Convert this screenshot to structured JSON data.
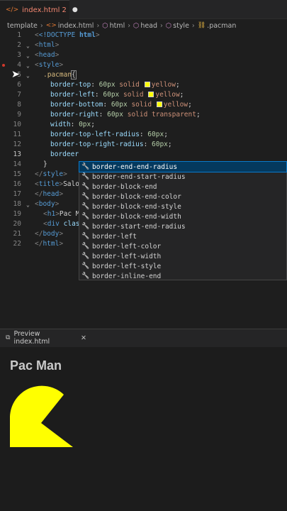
{
  "tab": {
    "title": "index.html",
    "problems": "2",
    "icon": "html-icon"
  },
  "breadcrumb": [
    "template",
    "index.html",
    "html",
    "head",
    "style",
    ".pacman"
  ],
  "editor": {
    "lines": [
      "1",
      "2",
      "3",
      "4",
      "5",
      "6",
      "7",
      "8",
      "9",
      "10",
      "11",
      "12",
      "13",
      "14",
      "15",
      "16",
      "17",
      "18",
      "19",
      "20",
      "21",
      "22"
    ],
    "code": {
      "l1a": "<!DOCTYPE ",
      "l1b": "html",
      "l2": "html",
      "l3": "head",
      "l4": "style",
      "l5": ".pacman",
      "l6p": "border-top",
      "l6n": "60px",
      "l6v": "solid",
      "l6c": "yellow",
      "l7p": "border-left",
      "l7n": "60px",
      "l7v": "solid",
      "l7c": "yellow",
      "l8p": "border-bottom",
      "l8n": "60px",
      "l8v": "solid",
      "l8c": "yellow",
      "l9p": "border-right",
      "l9n": "60px",
      "l9v": "solid transparent",
      "l10p": "width",
      "l10n": "0px",
      "l11p": "border-top-left-radius",
      "l11n": "60px",
      "l12p": "border-top-right-radius",
      "l12n": "60px",
      "l13": "bordeer",
      "l15": "style",
      "l16a": "title",
      "l16b": "Salo",
      "l17": "head",
      "l18": "body",
      "l19a": "h1",
      "l19b": "Pac M",
      "l20a": "div",
      "l20b": "clas",
      "l21": "body",
      "l22": "html"
    }
  },
  "suggestions": [
    {
      "label": "border-end-end-radius"
    },
    {
      "label": "border-end-start-radius"
    },
    {
      "label": "border-block-end"
    },
    {
      "label": "border-block-end-color"
    },
    {
      "label": "border-block-end-style"
    },
    {
      "label": "border-block-end-width"
    },
    {
      "label": "border-start-end-radius"
    },
    {
      "label": "border-left"
    },
    {
      "label": "border-left-color"
    },
    {
      "label": "border-left-width"
    },
    {
      "label": "border-left-style"
    },
    {
      "label": "border-inline-end"
    }
  ],
  "preview": {
    "tab": "Preview index.html",
    "heading": "Pac Man",
    "pacman_color": "#ffff00"
  }
}
